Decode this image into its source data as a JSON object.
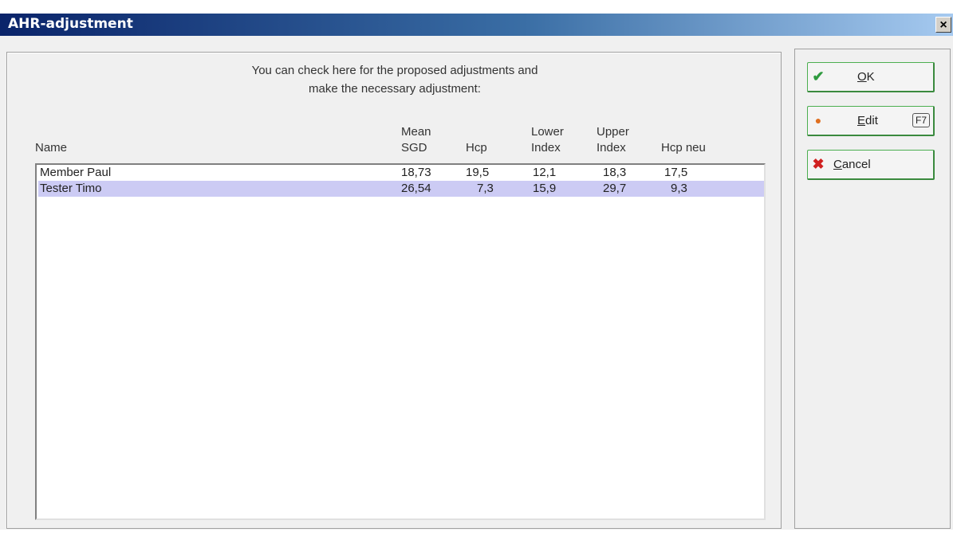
{
  "window": {
    "title": "AHR-adjustment",
    "close_glyph": "×"
  },
  "info_text": {
    "line1": "You can check here for the proposed adjustments and",
    "line2": "make the necessary adjustment:"
  },
  "table": {
    "headers": {
      "name": "Name",
      "mean_sgd_top": "Mean",
      "mean_sgd_bottom": "SGD",
      "hcp": "Hcp",
      "lower_top": "Lower",
      "lower_bottom": "Index",
      "upper_top": "Upper",
      "upper_bottom": "Index",
      "hcp_neu": "Hcp neu"
    },
    "rows": [
      {
        "name": "Member Paul",
        "mean_sgd": "18,73",
        "hcp": "19,5",
        "lower": "12,1",
        "upper": "18,3",
        "hcp_neu": "17,5",
        "selected": false
      },
      {
        "name": "Tester Timo",
        "mean_sgd": "26,54",
        "hcp": "7,3",
        "lower": "15,9",
        "upper": "29,7",
        "hcp_neu": "9,3",
        "selected": true
      }
    ],
    "selected_row_color": "#cccbf4"
  },
  "buttons": {
    "ok": {
      "mnemonic": "O",
      "rest": "K",
      "icon": "check-icon",
      "glyph": "✔",
      "color": "#2e9a3e"
    },
    "edit": {
      "mnemonic": "E",
      "rest": "dit",
      "shortcut": "F7",
      "icon": "circle-icon",
      "glyph": "●",
      "color": "#e07020"
    },
    "cancel": {
      "mnemonic": "C",
      "rest": "ancel",
      "icon": "cross-icon",
      "glyph": "✖",
      "color": "#d02020"
    }
  }
}
